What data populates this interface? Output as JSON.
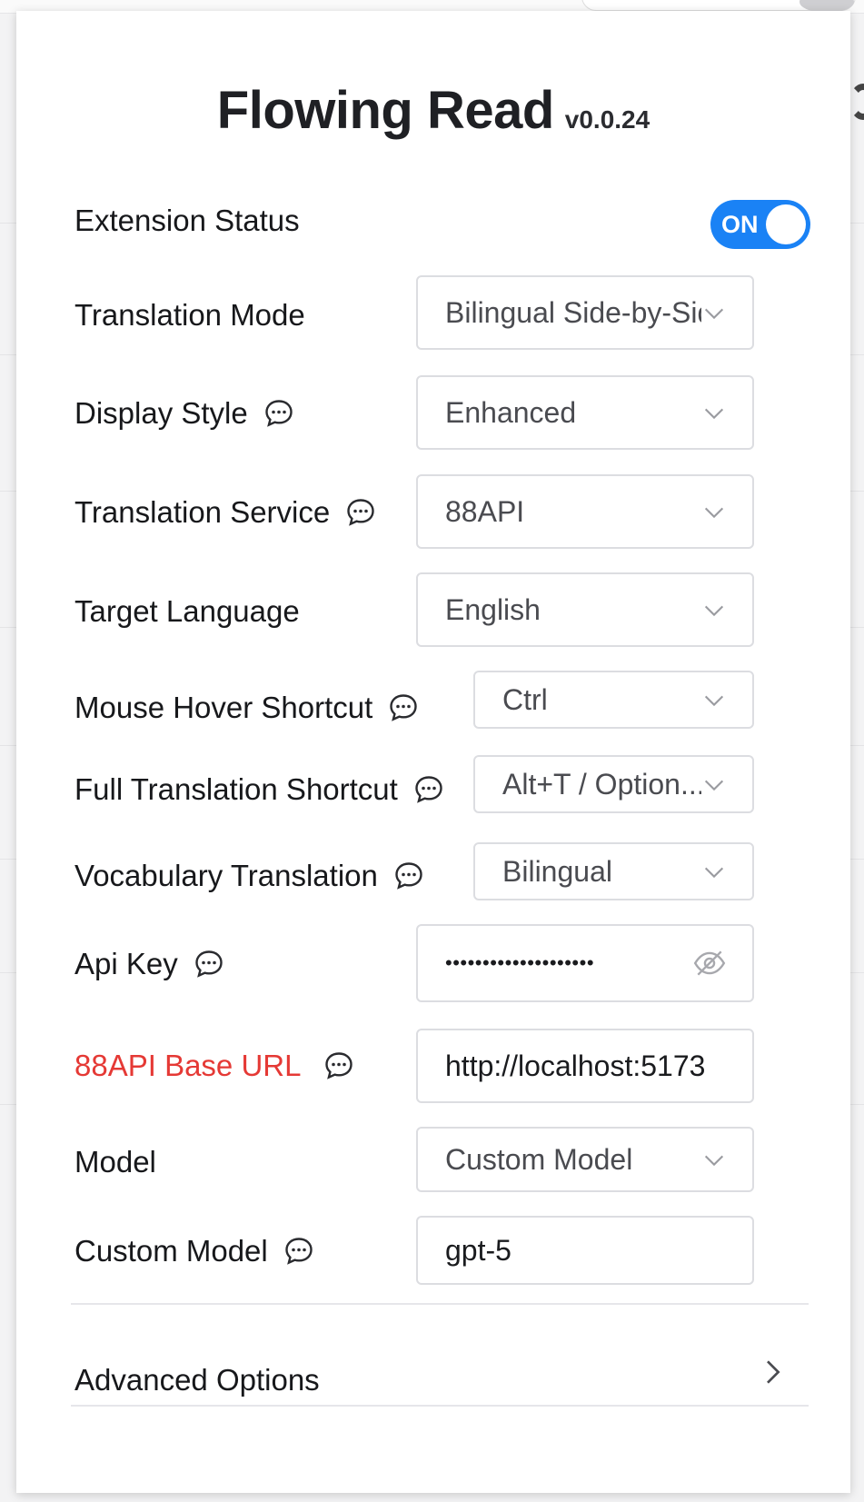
{
  "app": {
    "title": "Flowing Read",
    "version": "v0.0.24"
  },
  "status": {
    "label": "Extension Status",
    "toggle_text": "ON"
  },
  "settings": {
    "translation_mode": {
      "label": "Translation Mode",
      "value": "Bilingual Side-by-Side"
    },
    "display_style": {
      "label": "Display Style",
      "value": "Enhanced"
    },
    "translation_service": {
      "label": "Translation Service",
      "value": "88API"
    },
    "target_language": {
      "label": "Target Language",
      "value": "English"
    },
    "mouse_hover_shortcut": {
      "label": "Mouse Hover Shortcut",
      "value": "Ctrl"
    },
    "full_translation_shortcut": {
      "label": "Full Translation Shortcut",
      "value": "Alt+T / Option..."
    },
    "vocabulary_translation": {
      "label": "Vocabulary Translation",
      "value": "Bilingual"
    },
    "api_key": {
      "label": "Api Key",
      "value": "••••••••••••••••••••"
    },
    "base_url": {
      "label": "88API Base URL",
      "value": "http://localhost:5173"
    },
    "model": {
      "label": "Model",
      "value": "Custom Model"
    },
    "custom_model": {
      "label": "Custom Model",
      "value": "gpt-5"
    }
  },
  "advanced": {
    "label": "Advanced Options"
  },
  "colors": {
    "accent": "#1a82f5",
    "warning_label": "#e53935"
  },
  "icons": [
    "info-chat-icon",
    "chevron-down-icon",
    "eye-off-icon",
    "chevron-right-icon"
  ]
}
